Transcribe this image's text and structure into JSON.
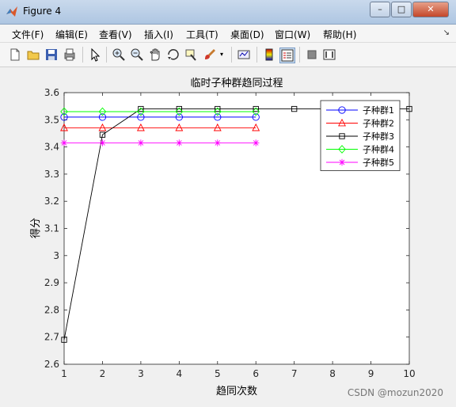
{
  "window": {
    "title": "Figure 4",
    "minimize": "–",
    "maximize": "□",
    "close": "✕"
  },
  "menu": [
    "文件(F)",
    "编辑(E)",
    "查看(V)",
    "插入(I)",
    "工具(T)",
    "桌面(D)",
    "窗口(W)",
    "帮助(H)"
  ],
  "toolbar": [
    "new-figure-icon",
    "open-file-icon",
    "save-icon",
    "print-icon",
    "pointer-icon",
    "zoom-in-icon",
    "zoom-out-icon",
    "pan-icon",
    "rotate-3d-icon",
    "data-cursor-icon",
    "brush-icon",
    "link-plot-icon",
    "colorbar-icon",
    "legend-icon",
    "hide-plot-tools-icon",
    "show-plot-tools-icon"
  ],
  "watermark": "CSDN @mozun2020",
  "chart_data": {
    "type": "line",
    "title": "临时子种群趋同过程",
    "xlabel": "趋同次数",
    "ylabel": "得分",
    "xlim": [
      1,
      10
    ],
    "ylim": [
      2.6,
      3.6
    ],
    "xticks": [
      1,
      2,
      3,
      4,
      5,
      6,
      7,
      8,
      9,
      10
    ],
    "yticks": [
      2.6,
      2.7,
      2.8,
      2.9,
      3.0,
      3.1,
      3.2,
      3.3,
      3.4,
      3.5,
      3.6
    ],
    "ytick_labels": [
      "2.6",
      "2.7",
      "2.8",
      "2.9",
      "3",
      "3.1",
      "3.2",
      "3.3",
      "3.4",
      "3.5",
      "3.6"
    ],
    "legend_position": "top-right",
    "grid": false,
    "series": [
      {
        "name": "子种群1",
        "color": "#0000ff",
        "marker": "circle",
        "x": [
          1,
          2,
          3,
          4,
          5,
          6
        ],
        "y": [
          3.51,
          3.51,
          3.51,
          3.51,
          3.51,
          3.51
        ]
      },
      {
        "name": "子种群2",
        "color": "#ff0000",
        "marker": "triangle",
        "x": [
          1,
          2,
          3,
          4,
          5,
          6
        ],
        "y": [
          3.47,
          3.47,
          3.47,
          3.47,
          3.47,
          3.47
        ]
      },
      {
        "name": "子种群3",
        "color": "#000000",
        "marker": "square",
        "x": [
          1,
          2,
          3,
          4,
          5,
          6,
          7,
          8,
          9,
          10
        ],
        "y": [
          2.69,
          3.445,
          3.54,
          3.54,
          3.54,
          3.54,
          3.54,
          3.54,
          3.54,
          3.54
        ]
      },
      {
        "name": "子种群4",
        "color": "#00ff00",
        "marker": "diamond",
        "x": [
          1,
          2,
          3,
          4,
          5,
          6
        ],
        "y": [
          3.53,
          3.53,
          3.53,
          3.53,
          3.53,
          3.53
        ]
      },
      {
        "name": "子种群5",
        "color": "#ff00ff",
        "marker": "star",
        "x": [
          1,
          2,
          3,
          4,
          5,
          6
        ],
        "y": [
          3.415,
          3.415,
          3.415,
          3.415,
          3.415,
          3.415
        ]
      }
    ]
  }
}
